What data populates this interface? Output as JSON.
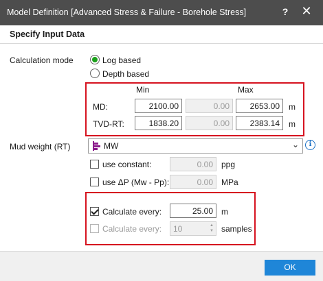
{
  "window": {
    "title": "Model Definition [Advanced Stress & Failure - Borehole Stress]",
    "help_glyph": "?",
    "close_glyph": "✕"
  },
  "heading": "Specify Input Data",
  "calculation_mode": {
    "label": "Calculation mode",
    "options": [
      {
        "label": "Log based",
        "selected": true
      },
      {
        "label": "Depth based",
        "selected": false
      }
    ]
  },
  "range": {
    "min_header": "Min",
    "max_header": "Max",
    "rows": [
      {
        "label": "MD:",
        "min": "2100.00",
        "mid": "0.00",
        "max": "2653.00",
        "unit": "m"
      },
      {
        "label": "TVD-RT:",
        "min": "1838.20",
        "mid": "0.00",
        "max": "2383.14",
        "unit": "m"
      }
    ]
  },
  "mud_weight": {
    "label": "Mud weight (RT)",
    "selected": "MW",
    "icon": "log-curve-icon",
    "use_constant": {
      "label": "use constant:",
      "checked": false,
      "value": "0.00",
      "unit": "ppg"
    },
    "use_dp": {
      "label": "use ΔP (Mw - Pp):",
      "checked": false,
      "value": "0.00",
      "unit": "MPa"
    }
  },
  "calculate": {
    "every_distance": {
      "label": "Calculate every:",
      "checked": true,
      "value": "25.00",
      "unit": "m"
    },
    "every_samples": {
      "label": "Calculate every:",
      "checked": false,
      "value": "10",
      "unit": "samples"
    }
  },
  "footer": {
    "ok_label": "OK"
  },
  "colors": {
    "titlebar": "#4d4d4d",
    "highlight_box": "#d6121f",
    "radio_selected": "#1aa01a",
    "ok_button": "#1f86d8",
    "log_icon": "#8b1a8b",
    "info_icon": "#1a6fc4"
  }
}
